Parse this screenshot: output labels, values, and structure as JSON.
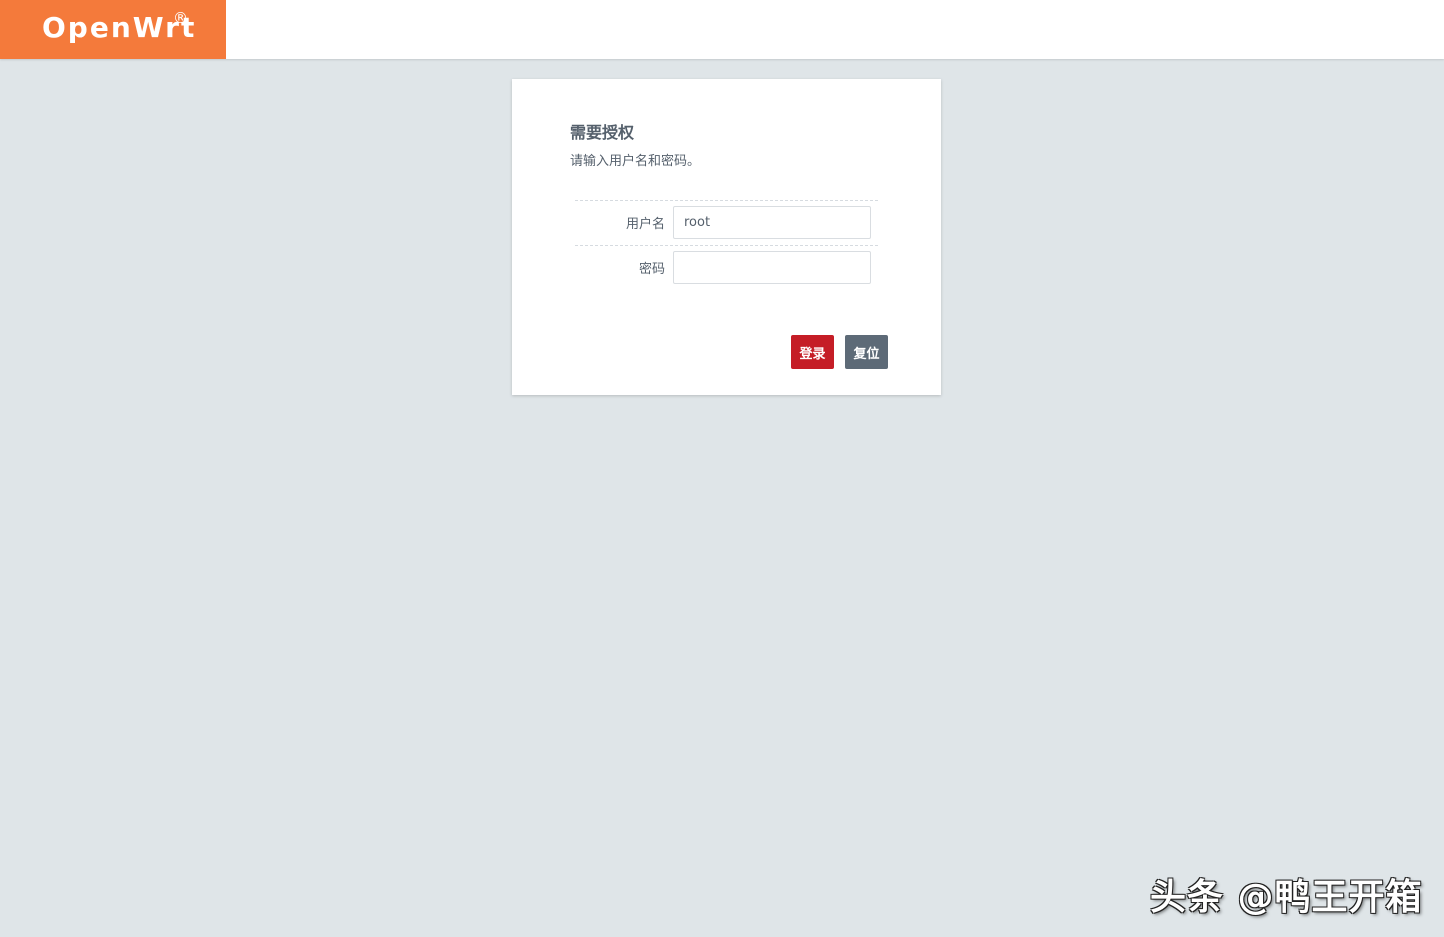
{
  "header": {
    "brand": "OpenWrt",
    "brand_mark": "®",
    "brand_color": "#f47a3b"
  },
  "login": {
    "title": "需要授权",
    "description": "请输入用户名和密码。",
    "username_label": "用户名",
    "username_value": "root",
    "password_label": "密码",
    "password_value": "",
    "login_button": "登录",
    "reset_button": "复位",
    "login_color": "#c51d26",
    "reset_color": "#5d6a77"
  },
  "watermark": {
    "text": "头条 @鸭王开箱"
  }
}
